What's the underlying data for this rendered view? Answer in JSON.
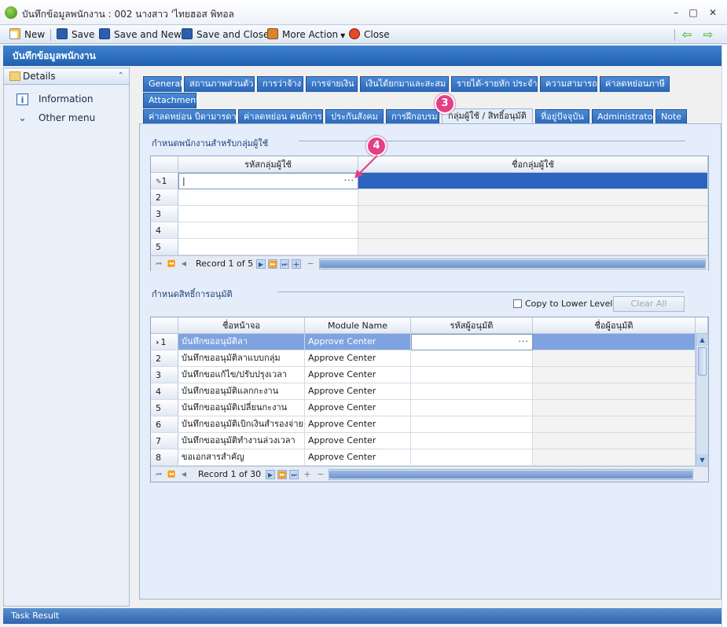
{
  "window": {
    "title": "บันทึกข้อมูลพนักงาน : 002 นางสาว 'ไทยฮอส พิทอล",
    "min": "–",
    "max": "□",
    "close": "✕"
  },
  "toolbar": {
    "new": "New",
    "save": "Save",
    "save_new": "Save and New",
    "save_close": "Save and Close",
    "more_action": "More Action",
    "close": "Close",
    "back_arrow": "⇦",
    "forward_arrow": "⇨"
  },
  "form_header": "บันทึกข้อมูลพนักงาน",
  "left_panel": {
    "header": "Details",
    "collapse_glyph": "⌃",
    "items": [
      {
        "label": "Information",
        "icon": "info-icon"
      },
      {
        "label": "Other menu",
        "icon": "chevrons-down-icon"
      }
    ]
  },
  "tabs_row1": [
    "General",
    "สถานภาพส่วนตัว",
    "การว่าจ้าง",
    "การจ่ายเงิน",
    "เงินได้ยกมาและสะสม",
    "รายได้-รายหัก ประจำ",
    "ความสามารถ",
    "ค่าลดหย่อนภาษี"
  ],
  "tabs_row2": [
    "Attachment"
  ],
  "tabs_row3": [
    "ค่าลดหย่อน บิดามารดา",
    "ค่าลดหย่อน คนพิการ",
    "ประกันสังคม",
    "การฝึกอบรม",
    "กลุ่มผู้ใช้ / สิทธิ์อนุมัติ",
    "ที่อยู่ปัจจุบัน",
    "Administrator",
    "Note"
  ],
  "annotations": {
    "badge_tab": "3",
    "badge_grid": "4"
  },
  "group_section": {
    "title": "กำหนดพนักงานสำหรับกลุ่มผู้ใช้",
    "columns": [
      "รหัสกลุ่มผู้ใช้",
      "ชื่อกลุ่มผู้ใช้"
    ],
    "rows": [
      "1",
      "2",
      "3",
      "4",
      "5"
    ],
    "ellipsis": "···",
    "cursor": "|",
    "nav": {
      "record": "Record 1 of 5",
      "plus": "+",
      "minus": "−"
    }
  },
  "approve_section": {
    "title": "กำหนดสิทธิ์การอนุมัติ",
    "copy_label": "Copy to Lower Level",
    "clear_all": "Clear All",
    "columns": [
      "ชื่อหน้าจอ",
      "Module Name",
      "รหัสผู้อนุมัติ",
      "ชื่อผู้อนุมัติ"
    ],
    "rows": [
      {
        "no": "1",
        "screen": "บันทึกขออนุมัติลา",
        "module": "Approve Center"
      },
      {
        "no": "2",
        "screen": "บันทึกขออนุมัติลาแบบกลุ่ม",
        "module": "Approve Center"
      },
      {
        "no": "3",
        "screen": "บันทึกขอแก้ไข/ปรับปรุงเวลา",
        "module": "Approve Center"
      },
      {
        "no": "4",
        "screen": "บันทึกขออนุมัติแลกกะงาน",
        "module": "Approve Center"
      },
      {
        "no": "5",
        "screen": "บันทึกขออนุมัติเปลี่ยนกะงาน",
        "module": "Approve Center"
      },
      {
        "no": "6",
        "screen": "บันทึกขออนุมัติเบิกเงินสำรองจ่าย",
        "module": "Approve Center"
      },
      {
        "no": "7",
        "screen": "บันทึกขออนุมัติทำงานล่วงเวลา",
        "module": "Approve Center"
      },
      {
        "no": "8",
        "screen": "ขอเอกสารสำคัญ",
        "module": "Approve Center"
      }
    ],
    "current_marker": "›",
    "ellipsis": "···",
    "nav": {
      "record": "Record 1 of 30",
      "plus": "+",
      "minus": "−"
    }
  },
  "status": "Task Result",
  "colors": {
    "accent": "#2c64c0",
    "tab": "#2a66b8",
    "badge": "#e33f86"
  }
}
